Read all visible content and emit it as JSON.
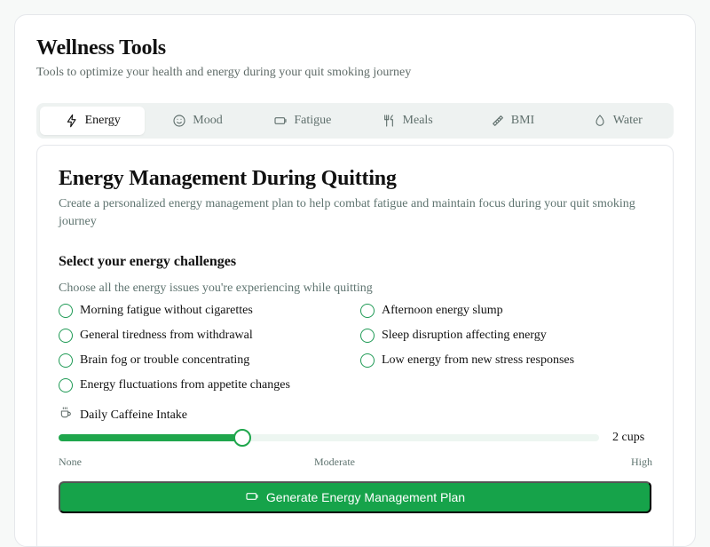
{
  "header": {
    "title": "Wellness Tools",
    "subtitle": "Tools to optimize your health and energy during your quit smoking journey"
  },
  "tabs": [
    {
      "label": "Energy",
      "icon": "lightning-icon",
      "active": true
    },
    {
      "label": "Mood",
      "icon": "smile-icon",
      "active": false
    },
    {
      "label": "Fatigue",
      "icon": "battery-icon",
      "active": false
    },
    {
      "label": "Meals",
      "icon": "utensils-icon",
      "active": false
    },
    {
      "label": "BMI",
      "icon": "ruler-icon",
      "active": false
    },
    {
      "label": "Water",
      "icon": "droplet-icon",
      "active": false
    }
  ],
  "panel": {
    "title": "Energy Management During Quitting",
    "description": "Create a personalized energy management plan to help combat fatigue and maintain focus during your quit smoking journey"
  },
  "challenges": {
    "heading": "Select your energy challenges",
    "helper": "Choose all the energy issues you're experiencing while quitting",
    "options": [
      {
        "label": "Morning fatigue without cigarettes",
        "checked": false
      },
      {
        "label": "Afternoon energy slump",
        "checked": false
      },
      {
        "label": "General tiredness from withdrawal",
        "checked": false
      },
      {
        "label": "Sleep disruption affecting energy",
        "checked": false
      },
      {
        "label": "Brain fog or trouble concentrating",
        "checked": false
      },
      {
        "label": "Low energy from new stress responses",
        "checked": false
      },
      {
        "label": "Energy fluctuations from appetite changes",
        "checked": false
      }
    ]
  },
  "caffeine": {
    "label": "Daily Caffeine Intake",
    "icon": "coffee-cup-icon",
    "value_text": "2 cups",
    "value": 2,
    "fill_fraction": 0.34,
    "scale": {
      "low": "None",
      "mid": "Moderate",
      "high": "High"
    }
  },
  "actions": {
    "generate_label": "Generate Energy Management Plan",
    "generate_icon": "battery-icon"
  },
  "colors": {
    "accent": "#16a34a",
    "accent_track": "#edf6f1",
    "muted_text": "#5f7470",
    "tab_background": "#eef2f1"
  }
}
